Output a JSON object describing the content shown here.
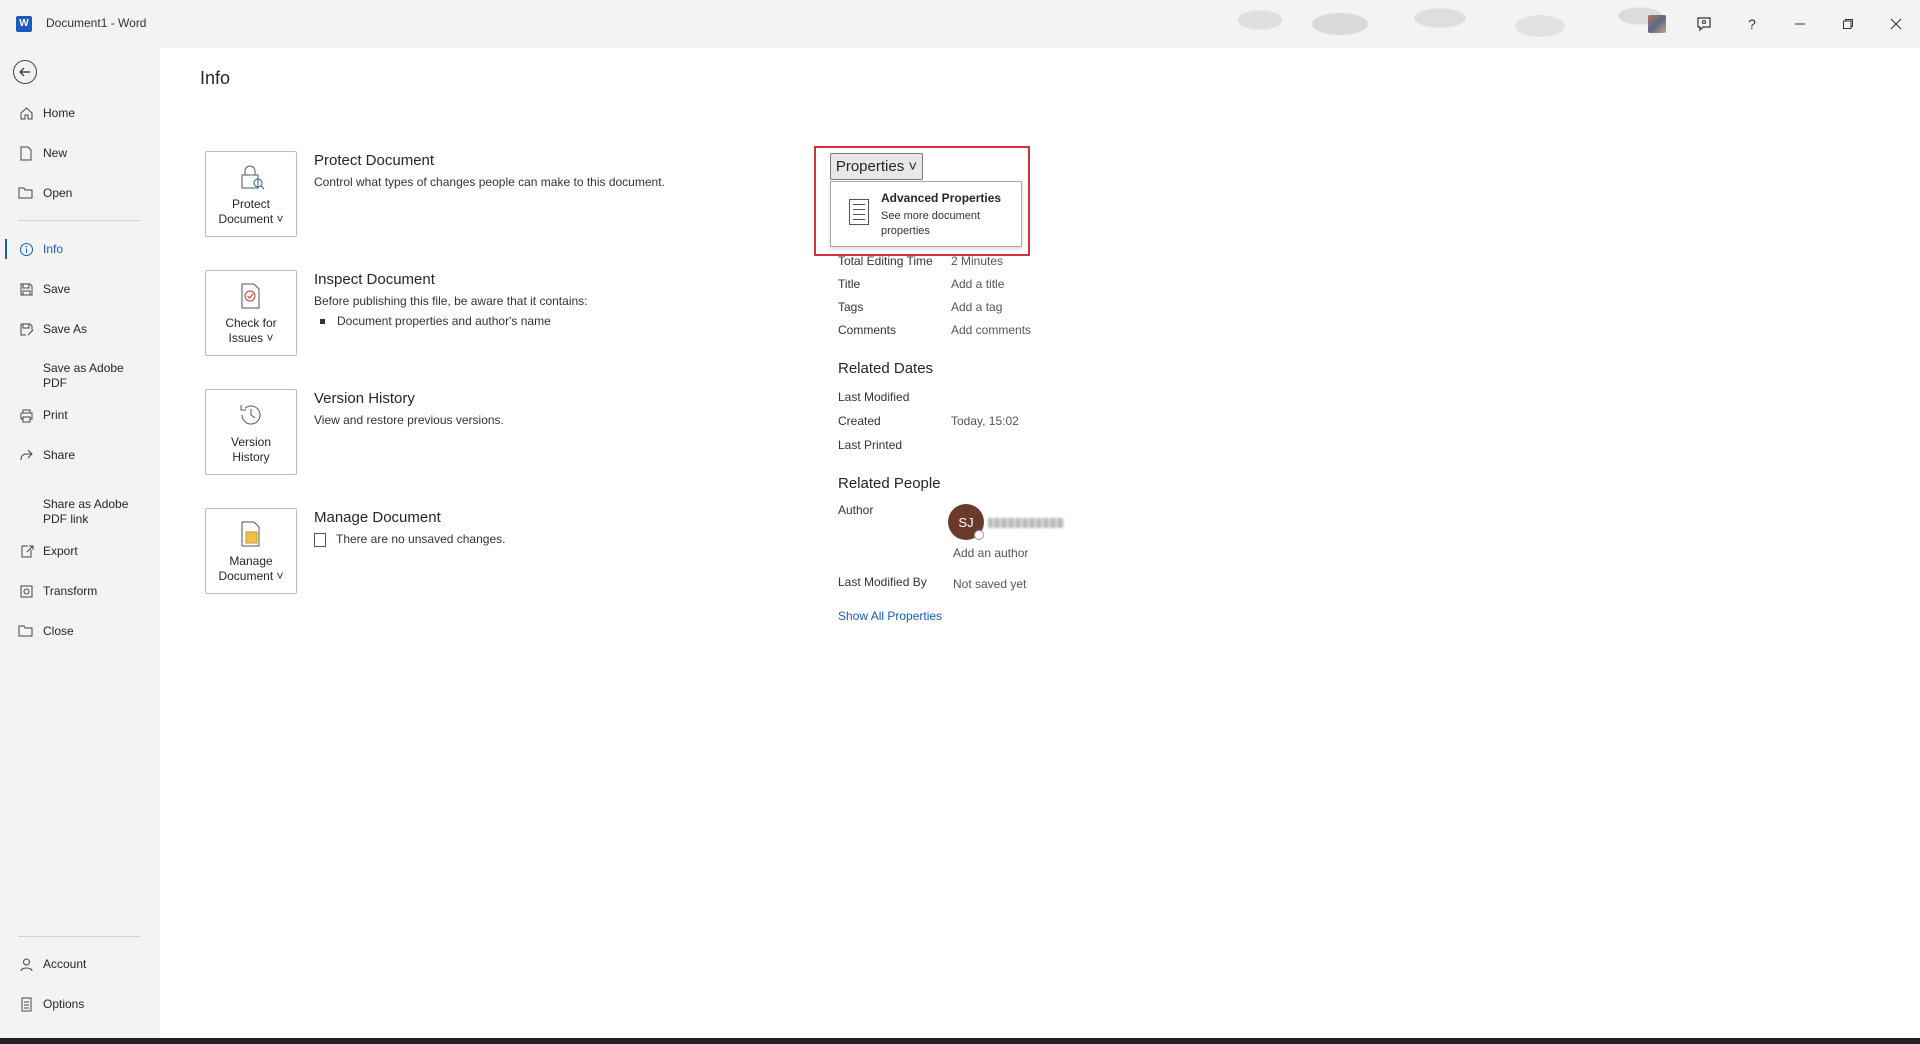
{
  "window": {
    "app_logo": "W",
    "title": "Document1  -  Word",
    "icons": [
      "profile-picture",
      "feedback-icon",
      "help-icon",
      "minimize-icon",
      "restore-icon",
      "close-icon"
    ],
    "help_glyph": "?"
  },
  "sidebar": {
    "items": [
      {
        "label": "Home",
        "icon": "home-icon"
      },
      {
        "label": "New",
        "icon": "new-document-icon"
      },
      {
        "label": "Open",
        "icon": "folder-open-icon"
      },
      {
        "label": "Info",
        "icon": "info-icon",
        "active": true
      },
      {
        "label": "Save",
        "icon": "save-icon"
      },
      {
        "label": "Save As",
        "icon": "save-as-icon"
      },
      {
        "label": "Save as Adobe PDF",
        "icon": ""
      },
      {
        "label": "Print",
        "icon": "print-icon"
      },
      {
        "label": "Share",
        "icon": "share-icon"
      },
      {
        "label": "Share as Adobe PDF link",
        "icon": ""
      },
      {
        "label": "Export",
        "icon": "export-icon"
      },
      {
        "label": "Transform",
        "icon": "transform-icon"
      },
      {
        "label": "Close",
        "icon": "close-folder-icon"
      }
    ],
    "bottom_items": [
      {
        "label": "Account",
        "icon": "account-icon"
      },
      {
        "label": "Options",
        "icon": "options-icon"
      }
    ]
  },
  "main": {
    "title": "Info",
    "sections": [
      {
        "card_line1": "Protect",
        "card_line2": "Document ˅",
        "heading": "Protect Document",
        "description": "Control what types of changes people can make to this document."
      },
      {
        "card_line1": "Check for",
        "card_line2": "Issues ˅",
        "heading": "Inspect Document",
        "description": "Before publishing this file, be aware that it contains:",
        "bullet": "Document properties and author's name"
      },
      {
        "card_line1": "Version",
        "card_line2": "History",
        "heading": "Version History",
        "description": "View and restore previous versions."
      },
      {
        "card_line1": "Manage",
        "card_line2": "Document ˅",
        "heading": "Manage Document",
        "description": "There are no unsaved changes."
      }
    ]
  },
  "properties": {
    "button_label": "Properties ˅",
    "dropdown": {
      "title": "Advanced Properties",
      "description": "See more document properties"
    },
    "rows": [
      {
        "label": "Total Editing Time",
        "value": "2 Minutes"
      },
      {
        "label": "Title",
        "value": "Add a title"
      },
      {
        "label": "Tags",
        "value": "Add a tag"
      },
      {
        "label": "Comments",
        "value": "Add comments"
      }
    ],
    "related_dates": {
      "heading": "Related Dates",
      "rows": [
        {
          "label": "Last Modified",
          "value": ""
        },
        {
          "label": "Created",
          "value": "Today, 15:02"
        },
        {
          "label": "Last Printed",
          "value": ""
        }
      ]
    },
    "related_people": {
      "heading": "Related People",
      "author_label": "Author",
      "author_initials": "SJ",
      "add_author": "Add an author",
      "last_modified_by_label": "Last Modified By",
      "last_modified_by_value": "Not saved yet"
    },
    "show_all": "Show All Properties"
  }
}
